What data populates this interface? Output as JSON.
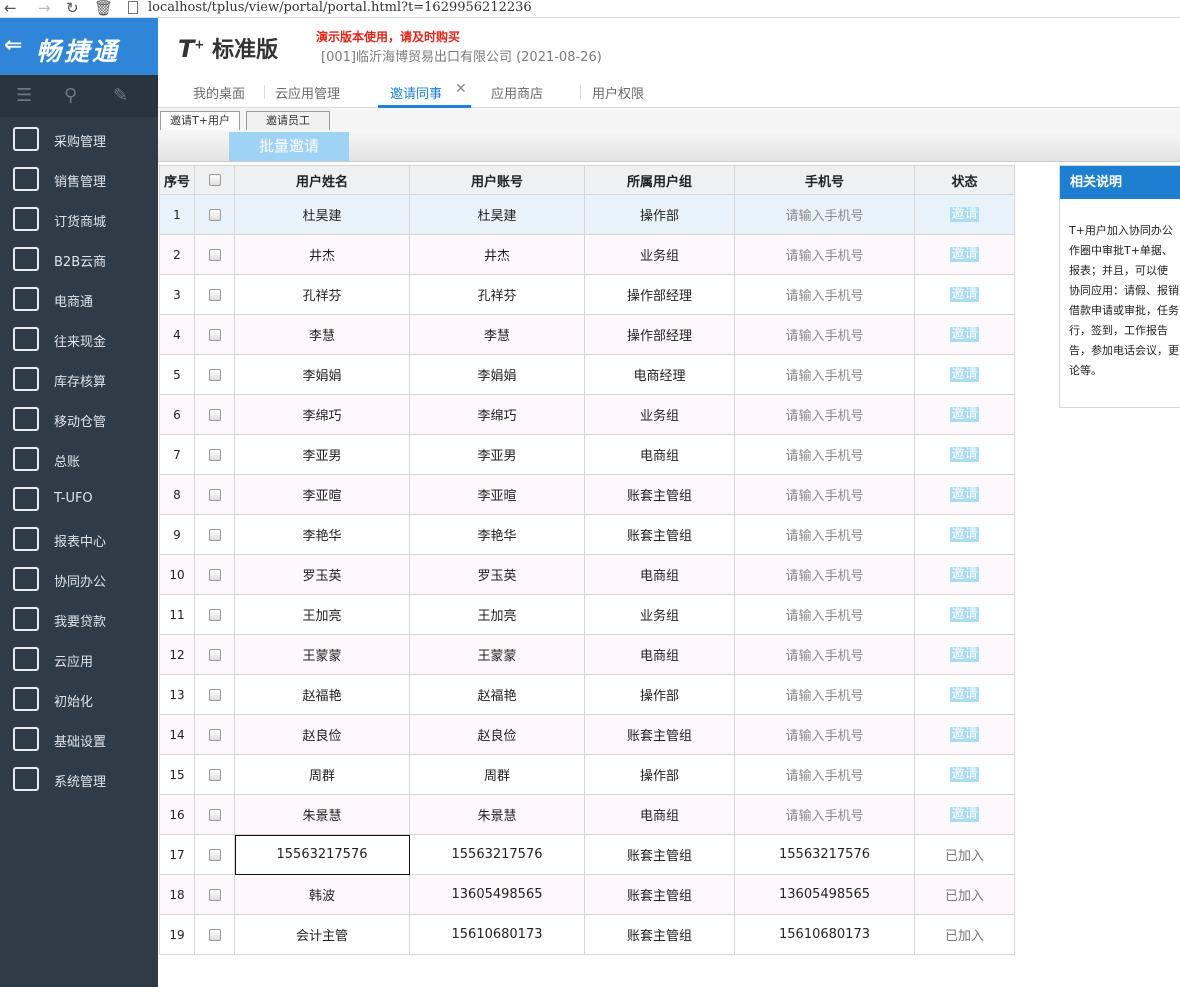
{
  "browser": {
    "url": "localhost/tplus/view/portal/portal.html?t=1629956212236"
  },
  "app": {
    "brand": "畅捷通",
    "product": "标准版",
    "demo_notice": "演示版本使用，请及时购买",
    "company": "[001]临沂海博贸易出口有限公司  (2021-08-26)"
  },
  "sidebar": {
    "items": [
      {
        "label": "采购管理",
        "icon": "purchase-icon"
      },
      {
        "label": "销售管理",
        "icon": "sales-chart-icon"
      },
      {
        "label": "订货商城",
        "icon": "store-icon"
      },
      {
        "label": "B2B云商",
        "icon": "b2b-icon"
      },
      {
        "label": "电商通",
        "icon": "ecommerce-icon"
      },
      {
        "label": "往来现金",
        "icon": "exchange-icon"
      },
      {
        "label": "库存核算",
        "icon": "inventory-icon"
      },
      {
        "label": "移动仓管",
        "icon": "mobile-warehouse-icon"
      },
      {
        "label": "总账",
        "icon": "ledger-icon"
      },
      {
        "label": "T-UFO",
        "icon": "ufo-icon"
      },
      {
        "label": "报表中心",
        "icon": "report-pie-icon"
      },
      {
        "label": "协同办公",
        "icon": "collaboration-icon"
      },
      {
        "label": "我要贷款",
        "icon": "loan-icon"
      },
      {
        "label": "云应用",
        "icon": "cloud-icon"
      },
      {
        "label": "初始化",
        "icon": "init-icon"
      },
      {
        "label": "基础设置",
        "icon": "settings-icon"
      },
      {
        "label": "系统管理",
        "icon": "system-icon"
      }
    ]
  },
  "tabs": [
    "我的桌面",
    "云应用管理",
    "邀请同事",
    "应用商店",
    "用户权限"
  ],
  "subtabs": [
    "邀请T+用户",
    "邀请员工"
  ],
  "toolbar": {
    "batch_invite": "批量邀请"
  },
  "table": {
    "headers": [
      "序号",
      "",
      "用户姓名",
      "用户账号",
      "所属用户组",
      "手机号",
      "状态"
    ],
    "rows": [
      {
        "no": "1",
        "name": "杜昊建",
        "account": "杜昊建",
        "group": "操作部",
        "phone": "请输入手机号",
        "status": "邀请"
      },
      {
        "no": "2",
        "name": "井杰",
        "account": "井杰",
        "group": "业务组",
        "phone": "请输入手机号",
        "status": "邀请"
      },
      {
        "no": "3",
        "name": "孔祥芬",
        "account": "孔祥芬",
        "group": "操作部经理",
        "phone": "请输入手机号",
        "status": "邀请"
      },
      {
        "no": "4",
        "name": "李慧",
        "account": "李慧",
        "group": "操作部经理",
        "phone": "请输入手机号",
        "status": "邀请"
      },
      {
        "no": "5",
        "name": "李娟娟",
        "account": "李娟娟",
        "group": "电商经理",
        "phone": "请输入手机号",
        "status": "邀请"
      },
      {
        "no": "6",
        "name": "李绵巧",
        "account": "李绵巧",
        "group": "业务组",
        "phone": "请输入手机号",
        "status": "邀请"
      },
      {
        "no": "7",
        "name": "李亚男",
        "account": "李亚男",
        "group": "电商组",
        "phone": "请输入手机号",
        "status": "邀请"
      },
      {
        "no": "8",
        "name": "李亚暄",
        "account": "李亚暄",
        "group": "账套主管组",
        "phone": "请输入手机号",
        "status": "邀请"
      },
      {
        "no": "9",
        "name": "李艳华",
        "account": "李艳华",
        "group": "账套主管组",
        "phone": "请输入手机号",
        "status": "邀请"
      },
      {
        "no": "10",
        "name": "罗玉英",
        "account": "罗玉英",
        "group": "电商组",
        "phone": "请输入手机号",
        "status": "邀请"
      },
      {
        "no": "11",
        "name": "王加亮",
        "account": "王加亮",
        "group": "业务组",
        "phone": "请输入手机号",
        "status": "邀请"
      },
      {
        "no": "12",
        "name": "王蒙蒙",
        "account": "王蒙蒙",
        "group": "电商组",
        "phone": "请输入手机号",
        "status": "邀请"
      },
      {
        "no": "13",
        "name": "赵福艳",
        "account": "赵福艳",
        "group": "操作部",
        "phone": "请输入手机号",
        "status": "邀请"
      },
      {
        "no": "14",
        "name": "赵良俭",
        "account": "赵良俭",
        "group": "账套主管组",
        "phone": "请输入手机号",
        "status": "邀请"
      },
      {
        "no": "15",
        "name": "周群",
        "account": "周群",
        "group": "操作部",
        "phone": "请输入手机号",
        "status": "邀请"
      },
      {
        "no": "16",
        "name": "朱景慧",
        "account": "朱景慧",
        "group": "电商组",
        "phone": "请输入手机号",
        "status": "邀请"
      },
      {
        "no": "17",
        "name": "15563217576",
        "account": "15563217576",
        "group": "账套主管组",
        "phone": "15563217576",
        "status": "已加入"
      },
      {
        "no": "18",
        "name": "韩波",
        "account": "13605498565",
        "group": "账套主管组",
        "phone": "13605498565",
        "status": "已加入"
      },
      {
        "no": "19",
        "name": "会计主管",
        "account": "15610680173",
        "group": "账套主管组",
        "phone": "15610680173",
        "status": "已加入"
      }
    ]
  },
  "help": {
    "title": "相关说明",
    "lines": [
      "T+用户加入协同办公",
      "作圈中审批T+单据、",
      "报表；并且，可以使",
      "协同应用：请假、报销",
      "借款申请或审批，任务",
      "行，签到，工作报告",
      "告，参加电话会议，更",
      "论等。"
    ]
  },
  "colors": {
    "sidebar_bg": "#2f3b47",
    "brand_bg": "#2f86d9",
    "accent": "#1e82d9",
    "invite_bg": "#a9dcf7",
    "demo_red": "#e1251b"
  }
}
